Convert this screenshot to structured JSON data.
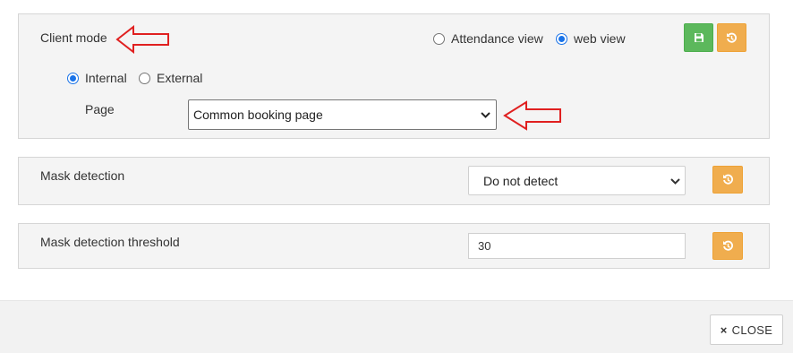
{
  "client_mode": {
    "title": "Client mode",
    "view_options": [
      {
        "label": "Attendance view",
        "checked": false
      },
      {
        "label": "web view",
        "checked": true
      }
    ],
    "access_options": [
      {
        "label": "Internal",
        "checked": true
      },
      {
        "label": "External",
        "checked": false
      }
    ],
    "page_label": "Page",
    "page_select_value": "Common booking page"
  },
  "mask_detection": {
    "title": "Mask detection",
    "select_value": "Do not detect"
  },
  "mask_threshold": {
    "title": "Mask detection threshold",
    "value": "30"
  },
  "footer": {
    "close_icon": "×",
    "close_label": "CLOSE"
  },
  "colors": {
    "save_button": "#5cb85c",
    "reset_button": "#f0ad4e",
    "annotation_arrow": "#e02020",
    "radio_accent": "#1a73e8"
  },
  "icons": {
    "save": "floppy-disk-icon",
    "reset": "undo-history-icon",
    "arrow": "left-arrow-annotation-icon"
  }
}
